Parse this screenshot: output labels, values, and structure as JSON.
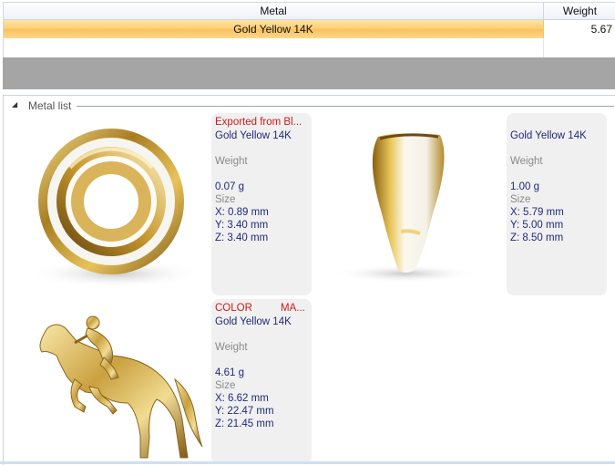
{
  "grid": {
    "headers": {
      "metal": "Metal",
      "weight": "Weight"
    },
    "row": {
      "metal": "Gold Yellow 14K",
      "weight": "5.67"
    }
  },
  "metal_list": {
    "title": "Metal list",
    "items": [
      {
        "header": "Exported from Bl...",
        "metal": "Gold Yellow 14K",
        "weight_label": "Weight",
        "weight": "0.07 g",
        "size_label": "Size",
        "x": "X: 0.89 mm",
        "y": "Y: 3.40 mm",
        "z": "Z: 3.40 mm",
        "image_icon": "gold-ring-flat-view"
      },
      {
        "header": "",
        "metal": "Gold Yellow 14K",
        "weight_label": "Weight",
        "weight": "1.00 g",
        "size_label": "Size",
        "x": "X: 5.79 mm",
        "y": "Y: 5.00 mm",
        "z": "Z: 8.50 mm",
        "image_icon": "gold-ring-side-view"
      },
      {
        "header_left": "COLOR=",
        "header_right": "MA...",
        "metal": "Gold Yellow 14K",
        "weight_label": "Weight",
        "weight": "4.61 g",
        "size_label": "Size",
        "x": "X: 6.62 mm",
        "y": "Y: 22.47 mm",
        "z": "Z: 21.45 mm",
        "image_icon": "gold-horse-rider-figure"
      }
    ]
  },
  "colors": {
    "selected_row": "#fccc70",
    "header_red": "#cc1b1b",
    "metal_navy": "#202a7a",
    "gray_band": "#a5a5a5",
    "card_bg": "#f0f0f0"
  }
}
